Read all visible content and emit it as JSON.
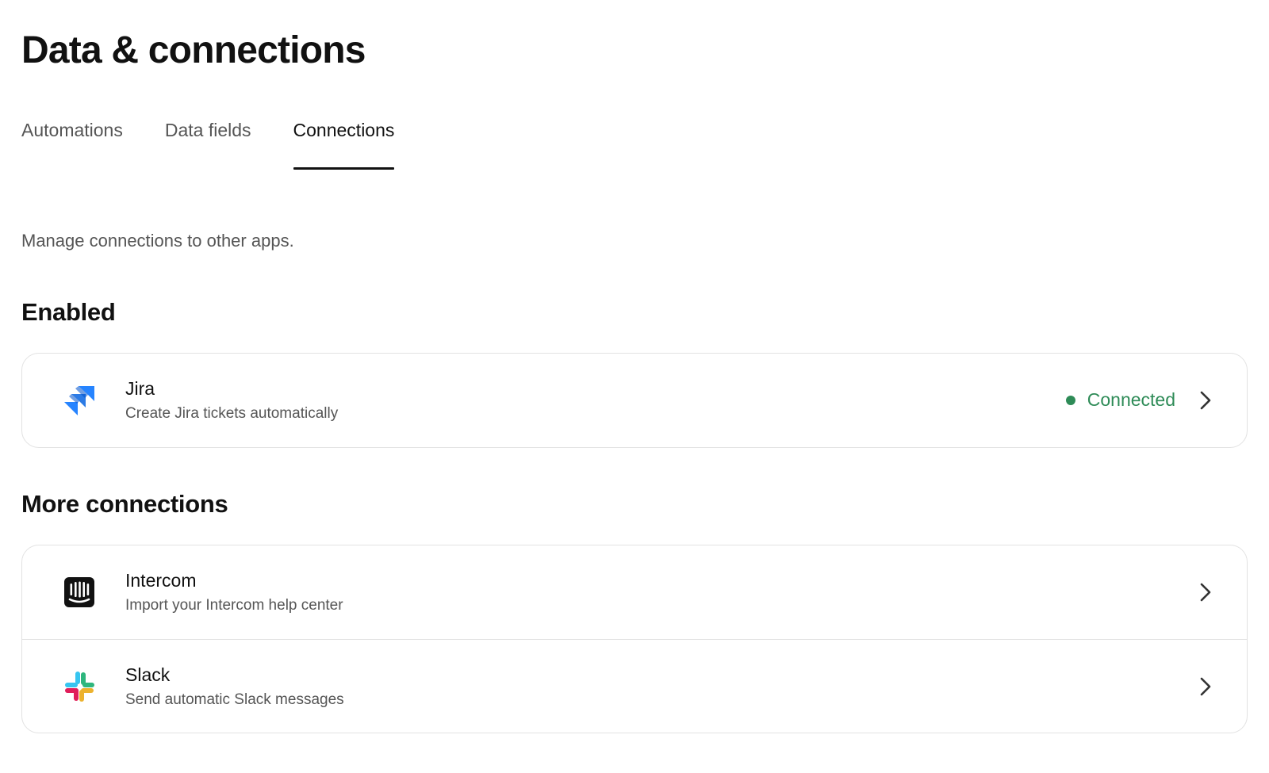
{
  "page": {
    "title": "Data & connections",
    "intro": "Manage connections to other apps."
  },
  "tabs": [
    {
      "label": "Automations",
      "active": false
    },
    {
      "label": "Data fields",
      "active": false
    },
    {
      "label": "Connections",
      "active": true
    }
  ],
  "sections": {
    "enabled": {
      "heading": "Enabled",
      "items": [
        {
          "name": "Jira",
          "description": "Create Jira tickets automatically",
          "icon": "jira-icon",
          "status": "Connected",
          "status_color": "#2e8b57"
        }
      ]
    },
    "more": {
      "heading": "More connections",
      "items": [
        {
          "name": "Intercom",
          "description": "Import your Intercom help center",
          "icon": "intercom-icon"
        },
        {
          "name": "Slack",
          "description": "Send automatic Slack messages",
          "icon": "slack-icon"
        }
      ]
    }
  },
  "colors": {
    "text_primary": "#111111",
    "text_secondary": "#555555",
    "border": "#e2e2e2",
    "connected": "#2e8b57",
    "jira_blue": "#2684ff",
    "slack_blue": "#36c5f0",
    "slack_green": "#2eb67d",
    "slack_yellow": "#ecb22e",
    "slack_red": "#e01e5a"
  }
}
